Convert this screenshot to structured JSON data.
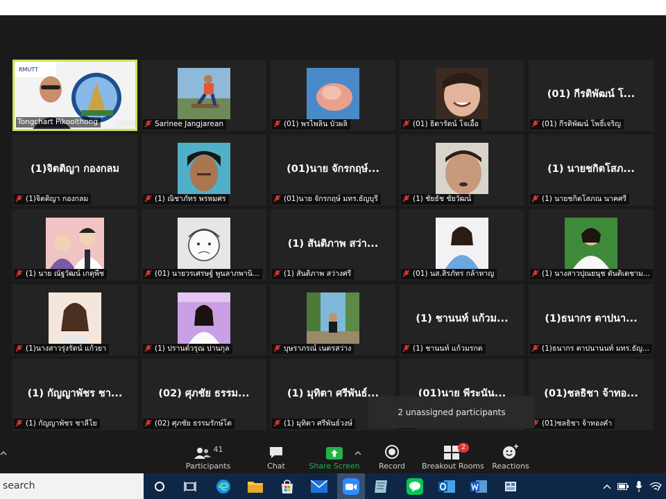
{
  "tiles": [
    {
      "caption": "Tongchart Pikoolthong",
      "big": "",
      "muted": false,
      "active": true,
      "photo": "presenter"
    },
    {
      "caption": "Sarinee Jangjarean",
      "big": "",
      "muted": true,
      "photo": "p1"
    },
    {
      "caption": "(01) พรไพลิน บัวผลิ",
      "big": "",
      "muted": true,
      "photo": "p2"
    },
    {
      "caption": "(01) ธิดารัตน์ โจเอื้อ",
      "big": "",
      "muted": true,
      "photo": "p3"
    },
    {
      "caption": "(01) กีรติพัฒน์ โพธิ์เจริญ",
      "big": "(01) กีรติพัฒน์ โ...",
      "muted": true
    },
    {
      "caption": "(1)จิตติญา กองกลม",
      "big": "(1)จิตติญา กองกลม",
      "muted": true
    },
    {
      "caption": "(1) ณิชาภัทร พรหมศร",
      "big": "",
      "muted": true,
      "photo": "p4"
    },
    {
      "caption": "(01)นาย จักรกฤษ์ มทร.ธัญบุรี",
      "big": "(01)นาย จักรกฤษ์...",
      "muted": true
    },
    {
      "caption": "(1) ชัยธัช ชัยวัฒน์",
      "big": "",
      "muted": true,
      "photo": "p5"
    },
    {
      "caption": "(1) นายชกิตโสภณ นาคศรี",
      "big": "(1) นายชกิตโสภ...",
      "muted": true
    },
    {
      "caption": "(1) นาย ณัฐวัฒน์ เกตุพืช",
      "big": "",
      "muted": true,
      "photo": "p6"
    },
    {
      "caption": "(01) นายวรเศรษฐ์ พูนลาภพานิ...",
      "big": "",
      "muted": true,
      "photo": "p7"
    },
    {
      "caption": "(1) สันติภาพ สว่างศรี",
      "big": "(1) สันติภาพ สว่า...",
      "muted": true
    },
    {
      "caption": "(01) นส.สิรภัทร กล้าหาญ",
      "big": "",
      "muted": true,
      "photo": "p8"
    },
    {
      "caption": "(1) นางสาวปุณยนุช ตันติเดชาม...",
      "big": "",
      "muted": true,
      "photo": "p9"
    },
    {
      "caption": "(1)นางสาวรุ่งรัตน์ แก้วยา",
      "big": "",
      "muted": true,
      "photo": "p10"
    },
    {
      "caption": "(1) ปรานต์วรุณ ปานกุล",
      "big": "",
      "muted": true,
      "photo": "p11"
    },
    {
      "caption": "บุษราภรณ์ เนตรสว่าง",
      "big": "",
      "muted": true,
      "photo": "p12"
    },
    {
      "caption": "(1) ชานนท์ แก้วมรกต",
      "big": "(1) ชานนท์ แก้วม...",
      "muted": true
    },
    {
      "caption": "(1)ธนากร ตาปนานนท์ มทร.ธัญ...",
      "big": "(1)ธนากร ตาปนา...",
      "muted": true
    },
    {
      "caption": "(1) กัญญาพัชร ชาลีโย",
      "big": "(1) กัญญาพัชร ชา...",
      "muted": true
    },
    {
      "caption": "(02) ศุภชัย ธรรมรักษ์โต",
      "big": "(02) ศุภชัย ธรรม...",
      "muted": true
    },
    {
      "caption": "(1) มุทิตา ศรีพันธ์วงษ์",
      "big": "(1) มุทิตา ศรีพันธ์...",
      "muted": true
    },
    {
      "caption": "",
      "big": "(01)นาย พีระนัน...",
      "muted": true
    },
    {
      "caption": "(01)ชลธิชา จ้าทองคำ",
      "big": "(01)ชลธิชา จ้าทอ...",
      "muted": true
    }
  ],
  "tooltip": "2 unassigned participants",
  "toolbar": {
    "participants_count": "41",
    "participants": "Participants",
    "chat": "Chat",
    "share_screen": "Share Screen",
    "record": "Record",
    "breakout_rooms": "Breakout Rooms",
    "breakout_badge": "2",
    "reactions": "Reactions"
  },
  "taskbar": {
    "search_text": "search"
  },
  "colors": {
    "muted_red": "#e0362c",
    "share_green": "#22b24c",
    "active_border": "#d4e05a",
    "badge_red": "#e0362c"
  }
}
